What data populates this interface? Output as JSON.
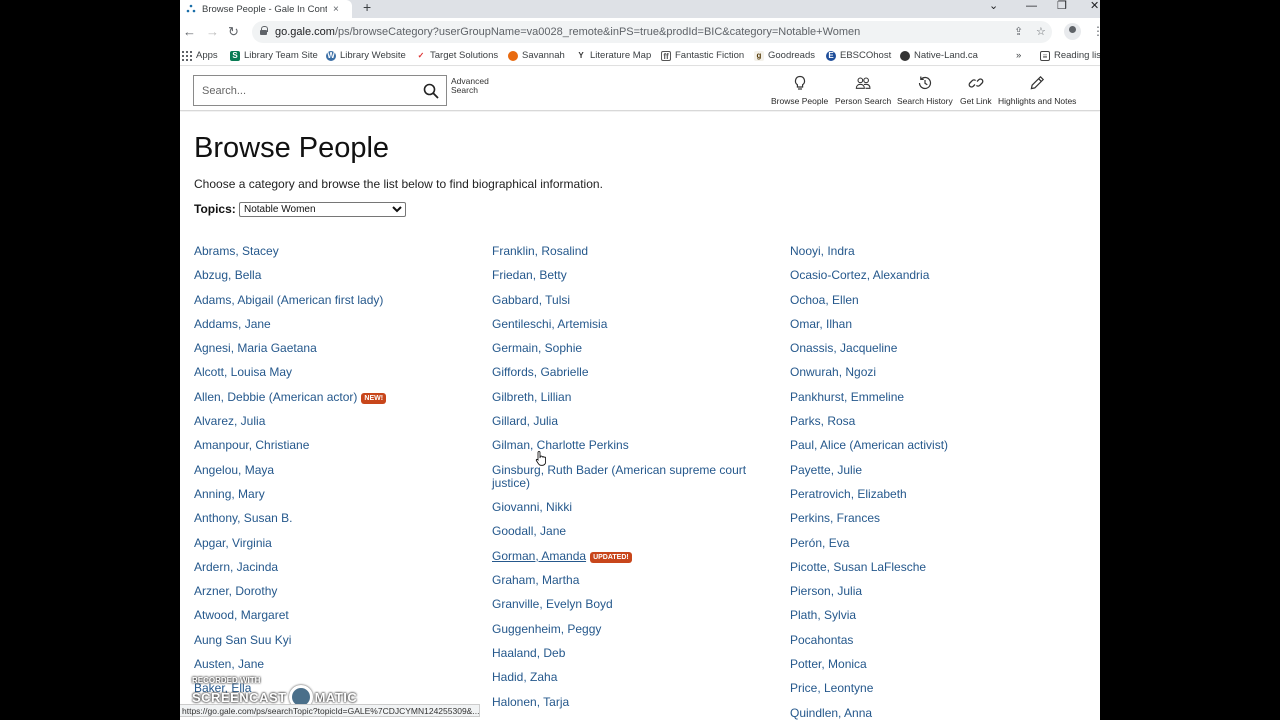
{
  "browser": {
    "tab_title": "Browse People - Gale In Context",
    "tab_close": "×",
    "new_tab": "+",
    "url_domain": "go.gale.com",
    "url_path": "/ps/browseCategory?userGroupName=va0028_remote&inPS=true&prodId=BIC&category=Notable+Women",
    "window_controls": {
      "collapse": "⌄",
      "minimize": "—",
      "restore": "❐",
      "close": "✕"
    },
    "bookmarks": [
      {
        "label": "Apps",
        "icon": "apps-grid-icon"
      },
      {
        "label": "Library Team Site",
        "icon": "sharepoint-icon",
        "color": "#0a7c55"
      },
      {
        "label": "Library Website",
        "icon": "wordpress-icon",
        "color": "#3a6ea5"
      },
      {
        "label": "Target Solutions",
        "icon": "target-solutions-icon",
        "color": "#d33"
      },
      {
        "label": "Savannah",
        "icon": "savannah-icon",
        "color": "#e86a10"
      },
      {
        "label": "Literature Map",
        "icon": "literature-map-icon",
        "color": "#333"
      },
      {
        "label": "Fantastic Fiction",
        "icon": "fantastic-fiction-icon",
        "color": "#555"
      },
      {
        "label": "Goodreads",
        "icon": "goodreads-icon",
        "color": "#b08d57"
      },
      {
        "label": "EBSCOhost",
        "icon": "ebscohost-icon",
        "color": "#1f4e9a"
      },
      {
        "label": "Native-Land.ca",
        "icon": "native-land-icon",
        "color": "#333"
      }
    ],
    "bookmarks_overflow": "»",
    "reading_list": "Reading list"
  },
  "header": {
    "search_placeholder": "Search...",
    "advanced_search": "Advanced Search",
    "tools": [
      {
        "label": "Browse People",
        "icon": "lightbulb-icon"
      },
      {
        "label": "Person Search",
        "icon": "people-icon"
      },
      {
        "label": "Search History",
        "icon": "history-icon"
      },
      {
        "label": "Get Link",
        "icon": "link-icon"
      },
      {
        "label": "Highlights and Notes",
        "icon": "pencil-icon"
      }
    ]
  },
  "page": {
    "title": "Browse People",
    "intro": "Choose a category and browse the list below to find biographical information.",
    "topics_label": "Topics:",
    "topics_selected": "Notable Women"
  },
  "people": {
    "col1": [
      {
        "name": "Abrams, Stacey"
      },
      {
        "name": "Abzug, Bella"
      },
      {
        "name": "Adams, Abigail (American first lady)"
      },
      {
        "name": "Addams, Jane"
      },
      {
        "name": "Agnesi, Maria Gaetana"
      },
      {
        "name": "Alcott, Louisa May"
      },
      {
        "name": "Allen, Debbie (American actor)",
        "badge": "NEW!"
      },
      {
        "name": "Alvarez, Julia"
      },
      {
        "name": "Amanpour, Christiane"
      },
      {
        "name": "Angelou, Maya"
      },
      {
        "name": "Anning, Mary"
      },
      {
        "name": "Anthony, Susan B."
      },
      {
        "name": "Apgar, Virginia"
      },
      {
        "name": "Ardern, Jacinda"
      },
      {
        "name": "Arzner, Dorothy"
      },
      {
        "name": "Atwood, Margaret"
      },
      {
        "name": "Aung San Suu Kyi"
      },
      {
        "name": "Austen, Jane"
      },
      {
        "name": "Baker, Ella"
      }
    ],
    "col2": [
      {
        "name": "Franklin, Rosalind"
      },
      {
        "name": "Friedan, Betty"
      },
      {
        "name": "Gabbard, Tulsi"
      },
      {
        "name": "Gentileschi, Artemisia"
      },
      {
        "name": "Germain, Sophie"
      },
      {
        "name": "Giffords, Gabrielle"
      },
      {
        "name": "Gilbreth, Lillian"
      },
      {
        "name": "Gillard, Julia"
      },
      {
        "name": "Gilman, Charlotte Perkins"
      },
      {
        "name": "Ginsburg, Ruth Bader (American supreme court justice)",
        "wrap": true
      },
      {
        "name": "Giovanni, Nikki"
      },
      {
        "name": "Goodall, Jane"
      },
      {
        "name": "Gorman, Amanda",
        "badge": "UPDATED!",
        "hover": true
      },
      {
        "name": "Graham, Martha"
      },
      {
        "name": "Granville, Evelyn Boyd"
      },
      {
        "name": "Guggenheim, Peggy"
      },
      {
        "name": "Haaland, Deb"
      },
      {
        "name": "Hadid, Zaha"
      },
      {
        "name": "Halonen, Tarja"
      }
    ],
    "col3": [
      {
        "name": "Nooyi, Indra"
      },
      {
        "name": "Ocasio-Cortez, Alexandria"
      },
      {
        "name": "Ochoa, Ellen"
      },
      {
        "name": "Omar, Ilhan"
      },
      {
        "name": "Onassis, Jacqueline"
      },
      {
        "name": "Onwurah, Ngozi"
      },
      {
        "name": "Pankhurst, Emmeline"
      },
      {
        "name": "Parks, Rosa"
      },
      {
        "name": "Paul, Alice (American activist)"
      },
      {
        "name": "Payette, Julie"
      },
      {
        "name": "Peratrovich, Elizabeth"
      },
      {
        "name": "Perkins, Frances"
      },
      {
        "name": "Perón, Eva"
      },
      {
        "name": "Picotte, Susan LaFlesche"
      },
      {
        "name": "Pierson, Julia"
      },
      {
        "name": "Plath, Sylvia"
      },
      {
        "name": "Pocahontas"
      },
      {
        "name": "Potter, Monica"
      },
      {
        "name": "Price, Leontyne"
      },
      {
        "name": "Quindlen, Anna"
      }
    ]
  },
  "overlay": {
    "watermark_small": "RECORDED WITH",
    "watermark_big_left": "SCREENCAST",
    "watermark_big_right": "MATIC",
    "status_url": "https://go.gale.com/ps/searchTopic?topicId=GALE%7CDJCYMN124255309&..."
  },
  "colors": {
    "link": "#25588c",
    "badge": "#c8461b"
  }
}
